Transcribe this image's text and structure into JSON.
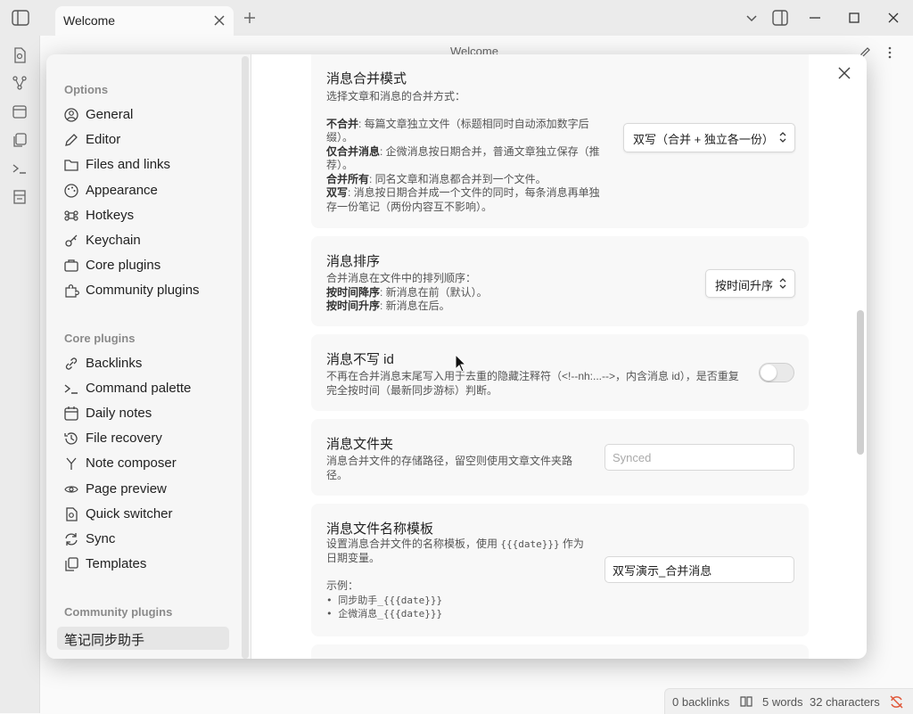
{
  "window": {
    "tab_title": "Welcome",
    "view_title": "Welcome"
  },
  "status_bar": {
    "backlinks": "0 backlinks",
    "words": "5 words",
    "characters": "32 characters"
  },
  "settings": {
    "sections": {
      "options": "Options",
      "core_plugins": "Core plugins",
      "community_plugins": "Community plugins"
    },
    "options_items": [
      {
        "label": "General",
        "icon": "user-circle-icon"
      },
      {
        "label": "Editor",
        "icon": "pencil-icon"
      },
      {
        "label": "Files and links",
        "icon": "folder-icon"
      },
      {
        "label": "Appearance",
        "icon": "palette-icon"
      },
      {
        "label": "Hotkeys",
        "icon": "command-icon"
      },
      {
        "label": "Keychain",
        "icon": "key-icon"
      },
      {
        "label": "Core plugins",
        "icon": "briefcase-icon"
      },
      {
        "label": "Community plugins",
        "icon": "puzzle-icon"
      }
    ],
    "core_plugin_items": [
      {
        "label": "Backlinks",
        "icon": "link-icon"
      },
      {
        "label": "Command palette",
        "icon": "terminal-icon"
      },
      {
        "label": "Daily notes",
        "icon": "calendar-icon"
      },
      {
        "label": "File recovery",
        "icon": "history-icon"
      },
      {
        "label": "Note composer",
        "icon": "merge-icon"
      },
      {
        "label": "Page preview",
        "icon": "preview-icon"
      },
      {
        "label": "Quick switcher",
        "icon": "file-search-icon"
      },
      {
        "label": "Sync",
        "icon": "sync-icon"
      },
      {
        "label": "Templates",
        "icon": "copy-icon"
      }
    ],
    "community_plugin_items": [
      {
        "label": "笔记同步助手"
      }
    ],
    "cards": {
      "merge_mode": {
        "title": "消息合并模式",
        "intro": "选择文章和消息的合并方式：",
        "opt1_b": "不合并",
        "opt1_t": ": 每篇文章独立文件（标题相同时自动添加数字后缀）。",
        "opt2_b": "仅合并消息",
        "opt2_t": ": 企微消息按日期合并，普通文章独立保存（推荐）。",
        "opt3_b": "合并所有",
        "opt3_t": ": 同名文章和消息都合并到一个文件。",
        "opt4_b": "双写",
        "opt4_t": ": 消息按日期合并成一个文件的同时，每条消息再单独存一份笔记（两份内容互不影响）。",
        "selected": "双写（合并 + 独立各一份）"
      },
      "sort": {
        "title": "消息排序",
        "intro": "合并消息在文件中的排列顺序：",
        "opt1_b": "按时间降序",
        "opt1_t": ": 新消息在前（默认）。",
        "opt2_b": "按时间升序",
        "opt2_t": ": 新消息在后。",
        "selected": "按时间升序"
      },
      "no_id": {
        "title": "消息不写 id",
        "desc": "不再在合并消息末尾写入用于去重的隐藏注释符（<!--nh:...-->，内含消息 id），是否重复完全按时间（最新同步游标）判断。",
        "enabled": false
      },
      "folder": {
        "title": "消息文件夹",
        "desc": "消息合并文件的存储路径，留空则使用文章文件夹路径。",
        "placeholder": "Synced",
        "value": ""
      },
      "name_template": {
        "title": "消息文件名称模板",
        "desc_a": "设置消息合并文件的名称模板，使用 ",
        "desc_code": "{{{date}}}",
        "desc_b": " 作为日期变量。",
        "example_label": "示例：",
        "example1": "• 同步助手_{{{date}}}",
        "example2": "• 企微消息_{{{date}}}",
        "value": "双写演示_合并消息"
      }
    }
  }
}
